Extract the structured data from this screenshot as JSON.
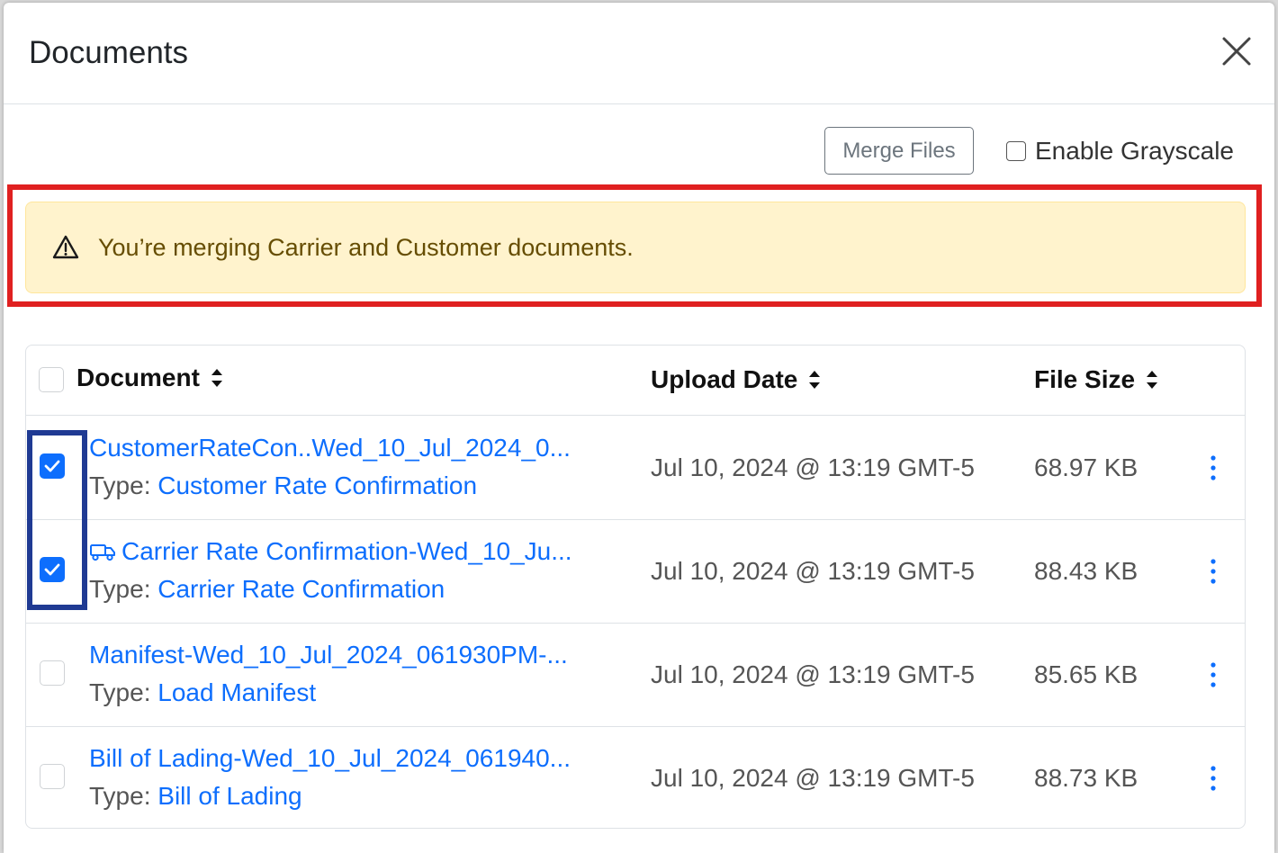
{
  "modal": {
    "title": "Documents",
    "close_icon": "close-icon"
  },
  "toolbar": {
    "merge_label": "Merge Files",
    "grayscale_label": "Enable Grayscale",
    "grayscale_checked": false
  },
  "alert": {
    "icon": "warning-triangle-icon",
    "message": "You’re merging Carrier and Customer documents."
  },
  "table": {
    "headers": {
      "document": "Document",
      "upload_date": "Upload Date",
      "file_size": "File Size"
    },
    "select_all_checked": false,
    "type_prefix": "Type:",
    "rows": [
      {
        "checked": true,
        "icon": "",
        "name": "CustomerRateCon..Wed_10_Jul_2024_0...",
        "type": "Customer Rate Confirmation",
        "upload_date": "Jul 10, 2024 @ 13:19 GMT-5",
        "file_size": "68.97 KB"
      },
      {
        "checked": true,
        "icon": "truck-icon",
        "name": "Carrier Rate Confirmation-Wed_10_Ju...",
        "type": "Carrier Rate Confirmation",
        "upload_date": "Jul 10, 2024 @ 13:19 GMT-5",
        "file_size": "88.43 KB"
      },
      {
        "checked": false,
        "icon": "",
        "name": "Manifest-Wed_10_Jul_2024_061930PM-...",
        "type": "Load Manifest",
        "upload_date": "Jul 10, 2024 @ 13:19 GMT-5",
        "file_size": "85.65 KB"
      },
      {
        "checked": false,
        "icon": "",
        "name": "Bill of Lading-Wed_10_Jul_2024_061940...",
        "type": "Bill of Lading",
        "upload_date": "Jul 10, 2024 @ 13:19 GMT-5",
        "file_size": "88.73 KB"
      }
    ]
  },
  "colors": {
    "primary": "#0d6efd",
    "alert_bg": "#fff3cd",
    "alert_text": "#664d03",
    "annotation_red": "#e02020",
    "annotation_blue": "#1f3a93"
  }
}
